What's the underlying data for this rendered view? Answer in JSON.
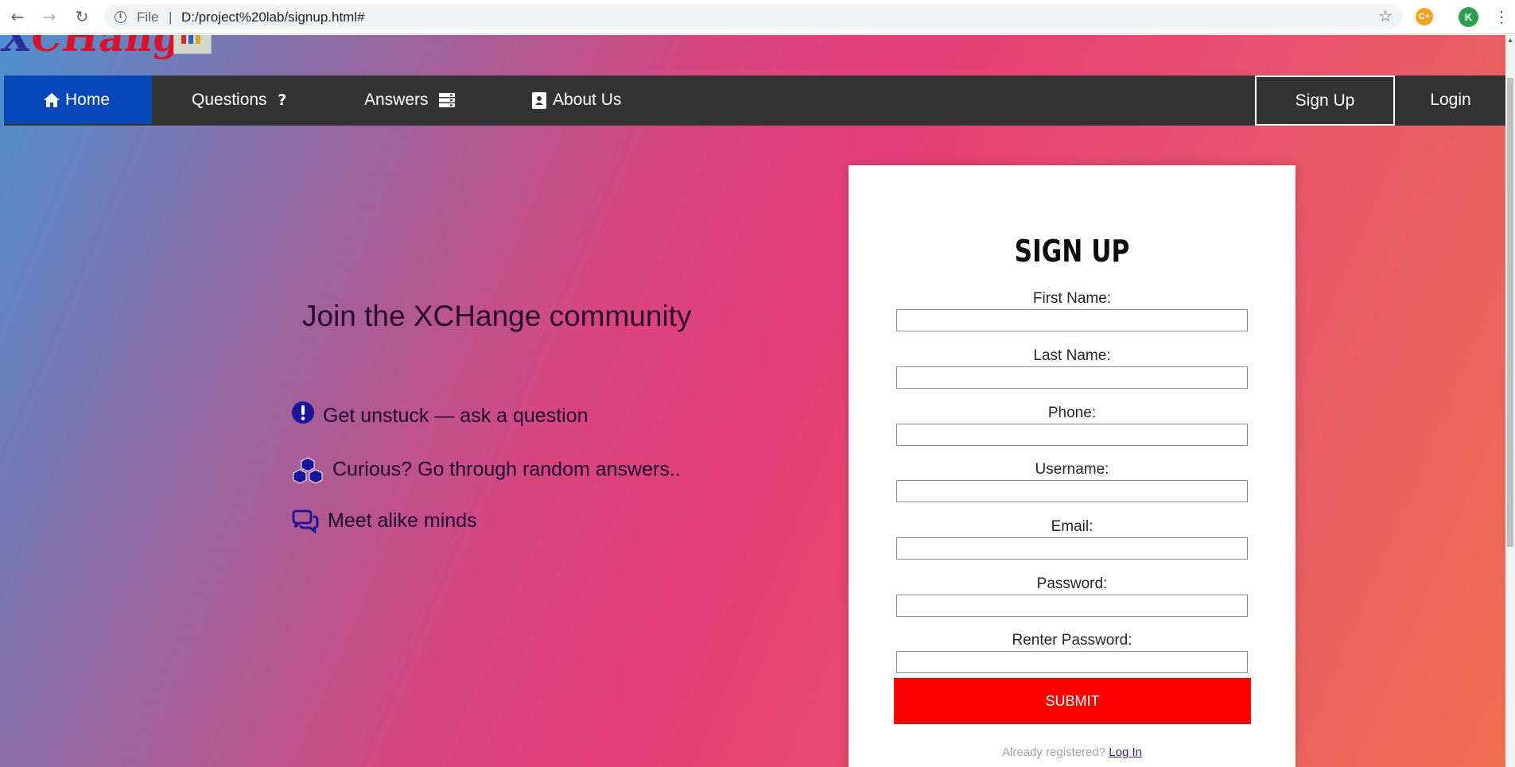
{
  "browser": {
    "scheme": "File",
    "separator": "|",
    "url": "D:/project%20lab/signup.html#",
    "extension_label": "C+",
    "profile_initial": "K"
  },
  "logo": {
    "x_letter": "X",
    "rest": "CHange"
  },
  "nav": {
    "items": [
      {
        "label": "Home",
        "icon": "home-icon"
      },
      {
        "label": "Questions",
        "icon": "question-icon"
      },
      {
        "label": "Answers",
        "icon": "server-icon"
      },
      {
        "label": "About Us",
        "icon": "address-book-icon"
      }
    ],
    "signup_label": "Sign Up",
    "login_label": "Login",
    "active_color": "#0748b9",
    "bar_color": "#333333"
  },
  "pitch": {
    "headline": "Join the XCHange community",
    "features": [
      {
        "text": "Get unstuck — ask a question",
        "icon": "exclamation-circle-icon"
      },
      {
        "text": "Curious? Go through random answers..",
        "icon": "cubes-icon"
      },
      {
        "text": "Meet alike minds",
        "icon": "comments-icon"
      }
    ]
  },
  "form": {
    "title": "SIGN UP",
    "fields": [
      {
        "label": "First Name:",
        "value": ""
      },
      {
        "label": "Last Name:",
        "value": ""
      },
      {
        "label": "Phone:",
        "value": ""
      },
      {
        "label": "Username:",
        "value": ""
      },
      {
        "label": "Email:",
        "value": ""
      },
      {
        "label": "Password:",
        "value": ""
      },
      {
        "label": "Renter Password:",
        "value": ""
      }
    ],
    "submit_label": "SUBMIT",
    "already_text": "Already registered?",
    "login_link": "Log In",
    "submit_color": "#ff0000"
  }
}
